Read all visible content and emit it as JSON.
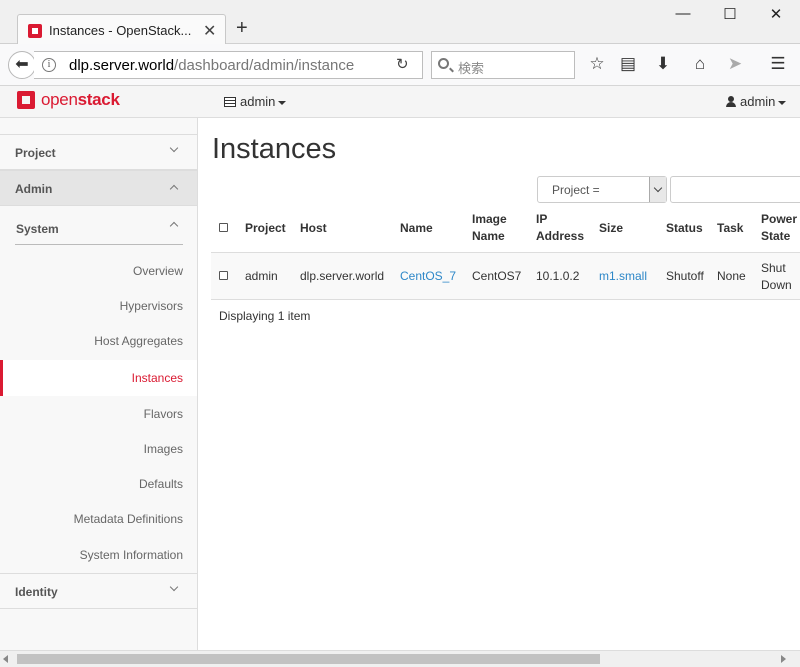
{
  "browser": {
    "tab_title": "Instances - OpenStack...",
    "new_tab": "+",
    "url_host": "dlp.server.world",
    "url_path": "/dashboard/admin/instance",
    "search_placeholder": "検索",
    "window_controls": {
      "minimize": "—",
      "maximize": "☐",
      "close": "✕"
    },
    "toolbar_icons": [
      "star-icon",
      "reading-list-icon",
      "download-icon",
      "home-icon",
      "send-icon",
      "menu-icon"
    ]
  },
  "header": {
    "brand_open": "open",
    "brand_stack": "stack",
    "project_label": "admin",
    "user_label": "admin"
  },
  "sidebar": {
    "project": "Project",
    "admin": "Admin",
    "system": "System",
    "items": [
      "Overview",
      "Hypervisors",
      "Host Aggregates",
      "Instances",
      "Flavors",
      "Images",
      "Defaults",
      "Metadata Definitions",
      "System Information"
    ],
    "active_item": "Instances",
    "identity": "Identity"
  },
  "main": {
    "title": "Instances",
    "filter_select": "Project =",
    "filter_input_value": "",
    "columns": {
      "project": "Project",
      "host": "Host",
      "name": "Name",
      "image_name_1": "Image",
      "image_name_2": "Name",
      "ip_1": "IP",
      "ip_2": "Address",
      "size": "Size",
      "status": "Status",
      "task": "Task",
      "power_1": "Power",
      "power_2": "State"
    },
    "rows": [
      {
        "project": "admin",
        "host": "dlp.server.world",
        "name": "CentOS_7",
        "image_name": "CentOS7",
        "ip": "10.1.0.2",
        "size": "m1.small",
        "status": "Shutoff",
        "task": "None",
        "power_1": "Shut",
        "power_2": "Down"
      }
    ],
    "footer": "Displaying 1 item"
  },
  "colors": {
    "accent": "#da1a32",
    "link": "#2d87c8"
  }
}
